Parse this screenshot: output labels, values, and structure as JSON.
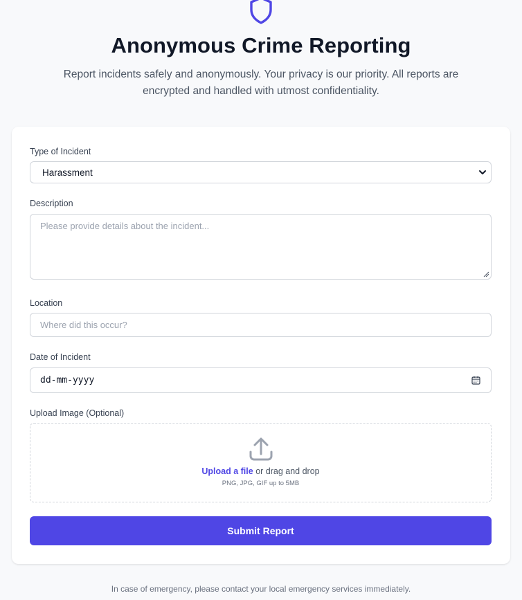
{
  "header": {
    "icon": "shield-icon",
    "title": "Anonymous Crime Reporting",
    "subtitle": "Report incidents safely and anonymously. Your privacy is our priority. All reports are encrypted and handled with utmost confidentiality."
  },
  "form": {
    "incident_type": {
      "label": "Type of Incident",
      "selected": "Harassment"
    },
    "description": {
      "label": "Description",
      "placeholder": "Please provide details about the incident..."
    },
    "location": {
      "label": "Location",
      "placeholder": "Where did this occur?"
    },
    "date": {
      "label": "Date of Incident",
      "placeholder": "dd-mm-yyyy"
    },
    "upload": {
      "label": "Upload Image (Optional)",
      "link_text": "Upload a file",
      "suffix_text": "or drag and drop",
      "hint": "PNG, JPG, GIF up to 5MB"
    },
    "submit_label": "Submit Report"
  },
  "footer": {
    "notice": "In case of emergency, please contact your local emergency services immediately."
  },
  "colors": {
    "accent": "#4f46e5",
    "background": "#f8f9fb",
    "card": "#ffffff",
    "border": "#d1d5db"
  }
}
